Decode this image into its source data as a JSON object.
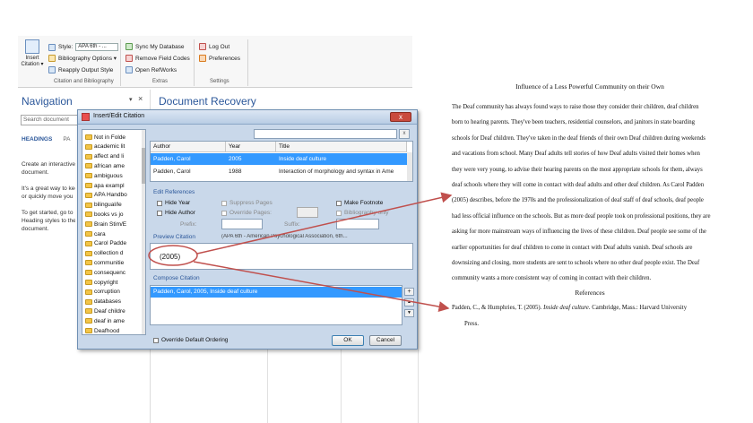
{
  "ribbon": {
    "insert_label_1": "Insert",
    "insert_label_2": "Citation ▾",
    "style_label": "Style:",
    "style_value": "APA 6th - ...",
    "bibliography_options": "Bibliography Options ▾",
    "reapply_output_style": "Reapply Output Style",
    "sync_my_database": "Sync My Database",
    "remove_field_codes": "Remove Field Codes",
    "open_refworks": "Open RefWorks",
    "log_out": "Log Out",
    "preferences": "Preferences",
    "group_citation": "Citation and Bibliography",
    "group_extras": "Extras",
    "group_settings": "Settings"
  },
  "navigation": {
    "title": "Navigation",
    "pin": "▾",
    "close": "×",
    "search_placeholder": "Search document",
    "tab_headings": "HEADINGS",
    "tab_pages": "PA",
    "text_1": "Create an interactive",
    "text_2": "document.",
    "text_3": "It's a great way to keep",
    "text_4": "or quickly move you",
    "text_5": "To get started, go to",
    "text_6": "Heading styles to the",
    "text_7": "document."
  },
  "recovery": {
    "title": "Document Recovery"
  },
  "dialog": {
    "title": "Insert/Edit Citation",
    "close": "x",
    "folders": [
      "Not in Folde",
      "academic lit",
      "affect and li",
      "african ame",
      "ambiguous",
      "apa exampl",
      "APA Handbo",
      "bilingual/le",
      "books vs jo",
      "Brain Stim/E",
      "cara",
      "Carol Padde",
      "collection d",
      "communitie",
      "consequenc",
      "copyright",
      "corruption",
      "databases",
      "Deaf childre",
      "deaf in ame",
      "Deafhood"
    ],
    "search_clear": "x",
    "results": {
      "headers": [
        "Author",
        "Year",
        "Title"
      ],
      "rows": [
        {
          "author": "Padden, Carol",
          "year": "2005",
          "title": "Inside deaf culture"
        },
        {
          "author": "Padden, Carol",
          "year": "1988",
          "title": "Interaction of morphology and syntax in Ame"
        }
      ]
    },
    "edit_references": "Edit References",
    "hide_year": "Hide Year",
    "hide_author": "Hide Author",
    "suppress_pages": "Suppress Pages",
    "override_pages": "Override Pages:",
    "make_footnote": "Make Footnote",
    "bibliography_only": "Bibliography only",
    "prefix": "Prefix:",
    "suffix": "Suffix:",
    "preview_citation": "Preview Citation",
    "preview_meta": "(APA 6th - American Psychological Association, 6th...",
    "preview_text": "(2005)",
    "compose_citation": "Compose Citation",
    "compose_row": "Padden, Carol, 2005, Inside deaf culture",
    "btn_add": "+",
    "btn_up": "▲",
    "btn_down": "▼",
    "override_default_ordering": "Override Default Ordering",
    "ok": "OK",
    "cancel": "Cancel"
  },
  "document": {
    "title": "Influence of a Less Powerful Community on their Own",
    "lines": [
      "The Deaf community has always found ways to raise those they consider their children, deaf children",
      "born to hearing parents. They've been teachers, residential counselors, and janitors in state boarding",
      "schools for Deaf children. They've taken in the deaf friends of their own Deaf children during weekends",
      "and vacations from school. Many Deaf adults tell stories of how Deaf adults visited their homes when",
      "they were very young, to advise their hearing parents on the most appropriate schools for them, always",
      "deaf schools where  they will come in contact with deaf adults and other deaf children. As Carol Padden",
      "(2005) describes, before the  1970s and the professionalization of deaf staff of deaf schools, deaf people",
      "had less official influence on the schools. But as more deaf people took on professional positions, they are",
      "asking for more mainstream ways of influencing the lives of these children. Deaf people see some of the",
      "earlier opportunities for deaf children to come in contact with Deaf adults vanish. Deaf schools are",
      "downsizing and closing, more students are sent to schools where no other deaf people exist. The Deaf",
      "community wants a more consistent way of coming in contact with their children."
    ],
    "references_heading": "References",
    "ref_line1_a": "Padden, C., & Humphries, T. (2005). ",
    "ref_line1_title": "Inside deaf culture",
    "ref_line1_b": ". Cambridge, Mass.: Harvard University",
    "ref_line2": "Press."
  },
  "colors": {
    "accent": "#2b579a",
    "selection": "#3399ff",
    "arrow": "#c0504d"
  }
}
